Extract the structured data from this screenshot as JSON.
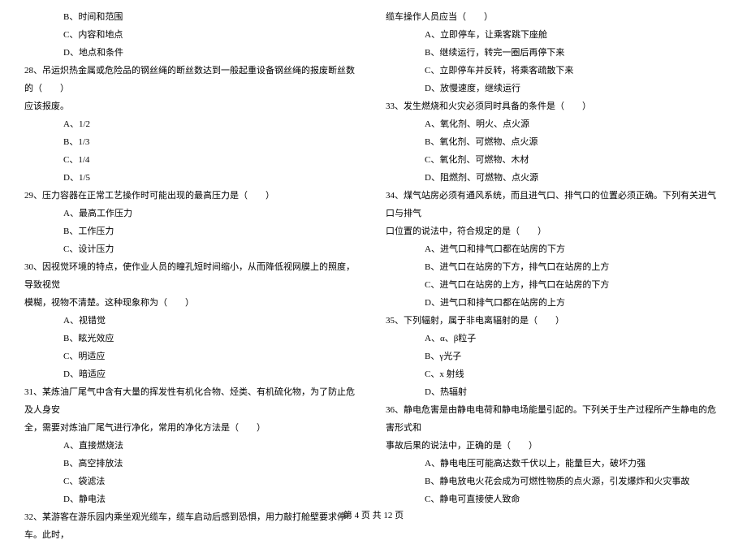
{
  "left": {
    "q27_opts": [
      "B、时间和范围",
      "C、内容和地点",
      "D、地点和条件"
    ],
    "q28": {
      "text": "28、吊运炽热金属或危险品的钢丝绳的断丝数达到一般起重设备钢丝绳的报废断丝数的（　　）",
      "cont": "应该报废。",
      "opts": [
        "A、1/2",
        "B、1/3",
        "C、1/4",
        "D、1/5"
      ]
    },
    "q29": {
      "text": "29、压力容器在正常工艺操作时可能出现的最高压力是（　　）",
      "opts": [
        "A、最高工作压力",
        "B、工作压力",
        "C、设计压力"
      ]
    },
    "q30": {
      "text": "30、因视觉环境的特点，使作业人员的瞳孔短时间缩小，从而降低视网膜上的照度，导致视觉",
      "cont": "模糊，视物不清楚。这种现象称为（　　）",
      "opts": [
        "A、视错觉",
        "B、眩光效应",
        "C、明适应",
        "D、暗适应"
      ]
    },
    "q31": {
      "text": "31、某炼油厂尾气中含有大量的挥发性有机化合物、烃类、有机硫化物，为了防止危及人身安",
      "cont": "全，需要对炼油厂尾气进行净化，常用的净化方法是（　　）",
      "opts": [
        "A、直接燃烧法",
        "B、高空排放法",
        "C、袋滤法",
        "D、静电法"
      ]
    },
    "q32": {
      "text": "32、某游客在游乐园内乘坐观光缆车，缆车启动后感到恐惧，用力敲打舱壁要求停车。此时，"
    }
  },
  "right": {
    "q32_cont": {
      "text": "缆车操作人员应当（　　）",
      "opts": [
        "A、立即停车，让乘客跳下座舱",
        "B、继续运行，转完一圈后再停下来",
        "C、立即停车并反转，将乘客疏散下来",
        "D、放慢速度，继续运行"
      ]
    },
    "q33": {
      "text": "33、发生燃烧和火灾必须同时具备的条件是（　　）",
      "opts": [
        "A、氧化剂、明火、点火源",
        "B、氧化剂、可燃物、点火源",
        "C、氧化剂、可燃物、木材",
        "D、阻燃剂、可燃物、点火源"
      ]
    },
    "q34": {
      "text": "34、煤气站房必须有通风系统，而且进气口、排气口的位置必须正确。下列有关进气口与排气",
      "cont": "口位置的说法中，符合规定的是（　　）",
      "opts": [
        "A、进气口和排气口都在站房的下方",
        "B、进气口在站房的下方，排气口在站房的上方",
        "C、进气口在站房的上方，排气口在站房的下方",
        "D、进气口和排气口都在站房的上方"
      ]
    },
    "q35": {
      "text": "35、下列辐射，属于非电离辐射的是（　　）",
      "opts": [
        "A、α、β粒子",
        "B、γ光子",
        "C、x 射线",
        "D、热辐射"
      ]
    },
    "q36": {
      "text": "36、静电危害是由静电电荷和静电场能量引起的。下列关于生产过程所产生静电的危害形式和",
      "cont": "事故后果的说法中，正确的是（　　）",
      "opts": [
        "A、静电电压可能高达数千伏以上，能量巨大，破坏力强",
        "B、静电放电火花会成为可燃性物质的点火源，引发爆炸和火灾事故",
        "C、静电可直接使人致命"
      ]
    }
  },
  "footer": "第 4 页 共 12 页"
}
